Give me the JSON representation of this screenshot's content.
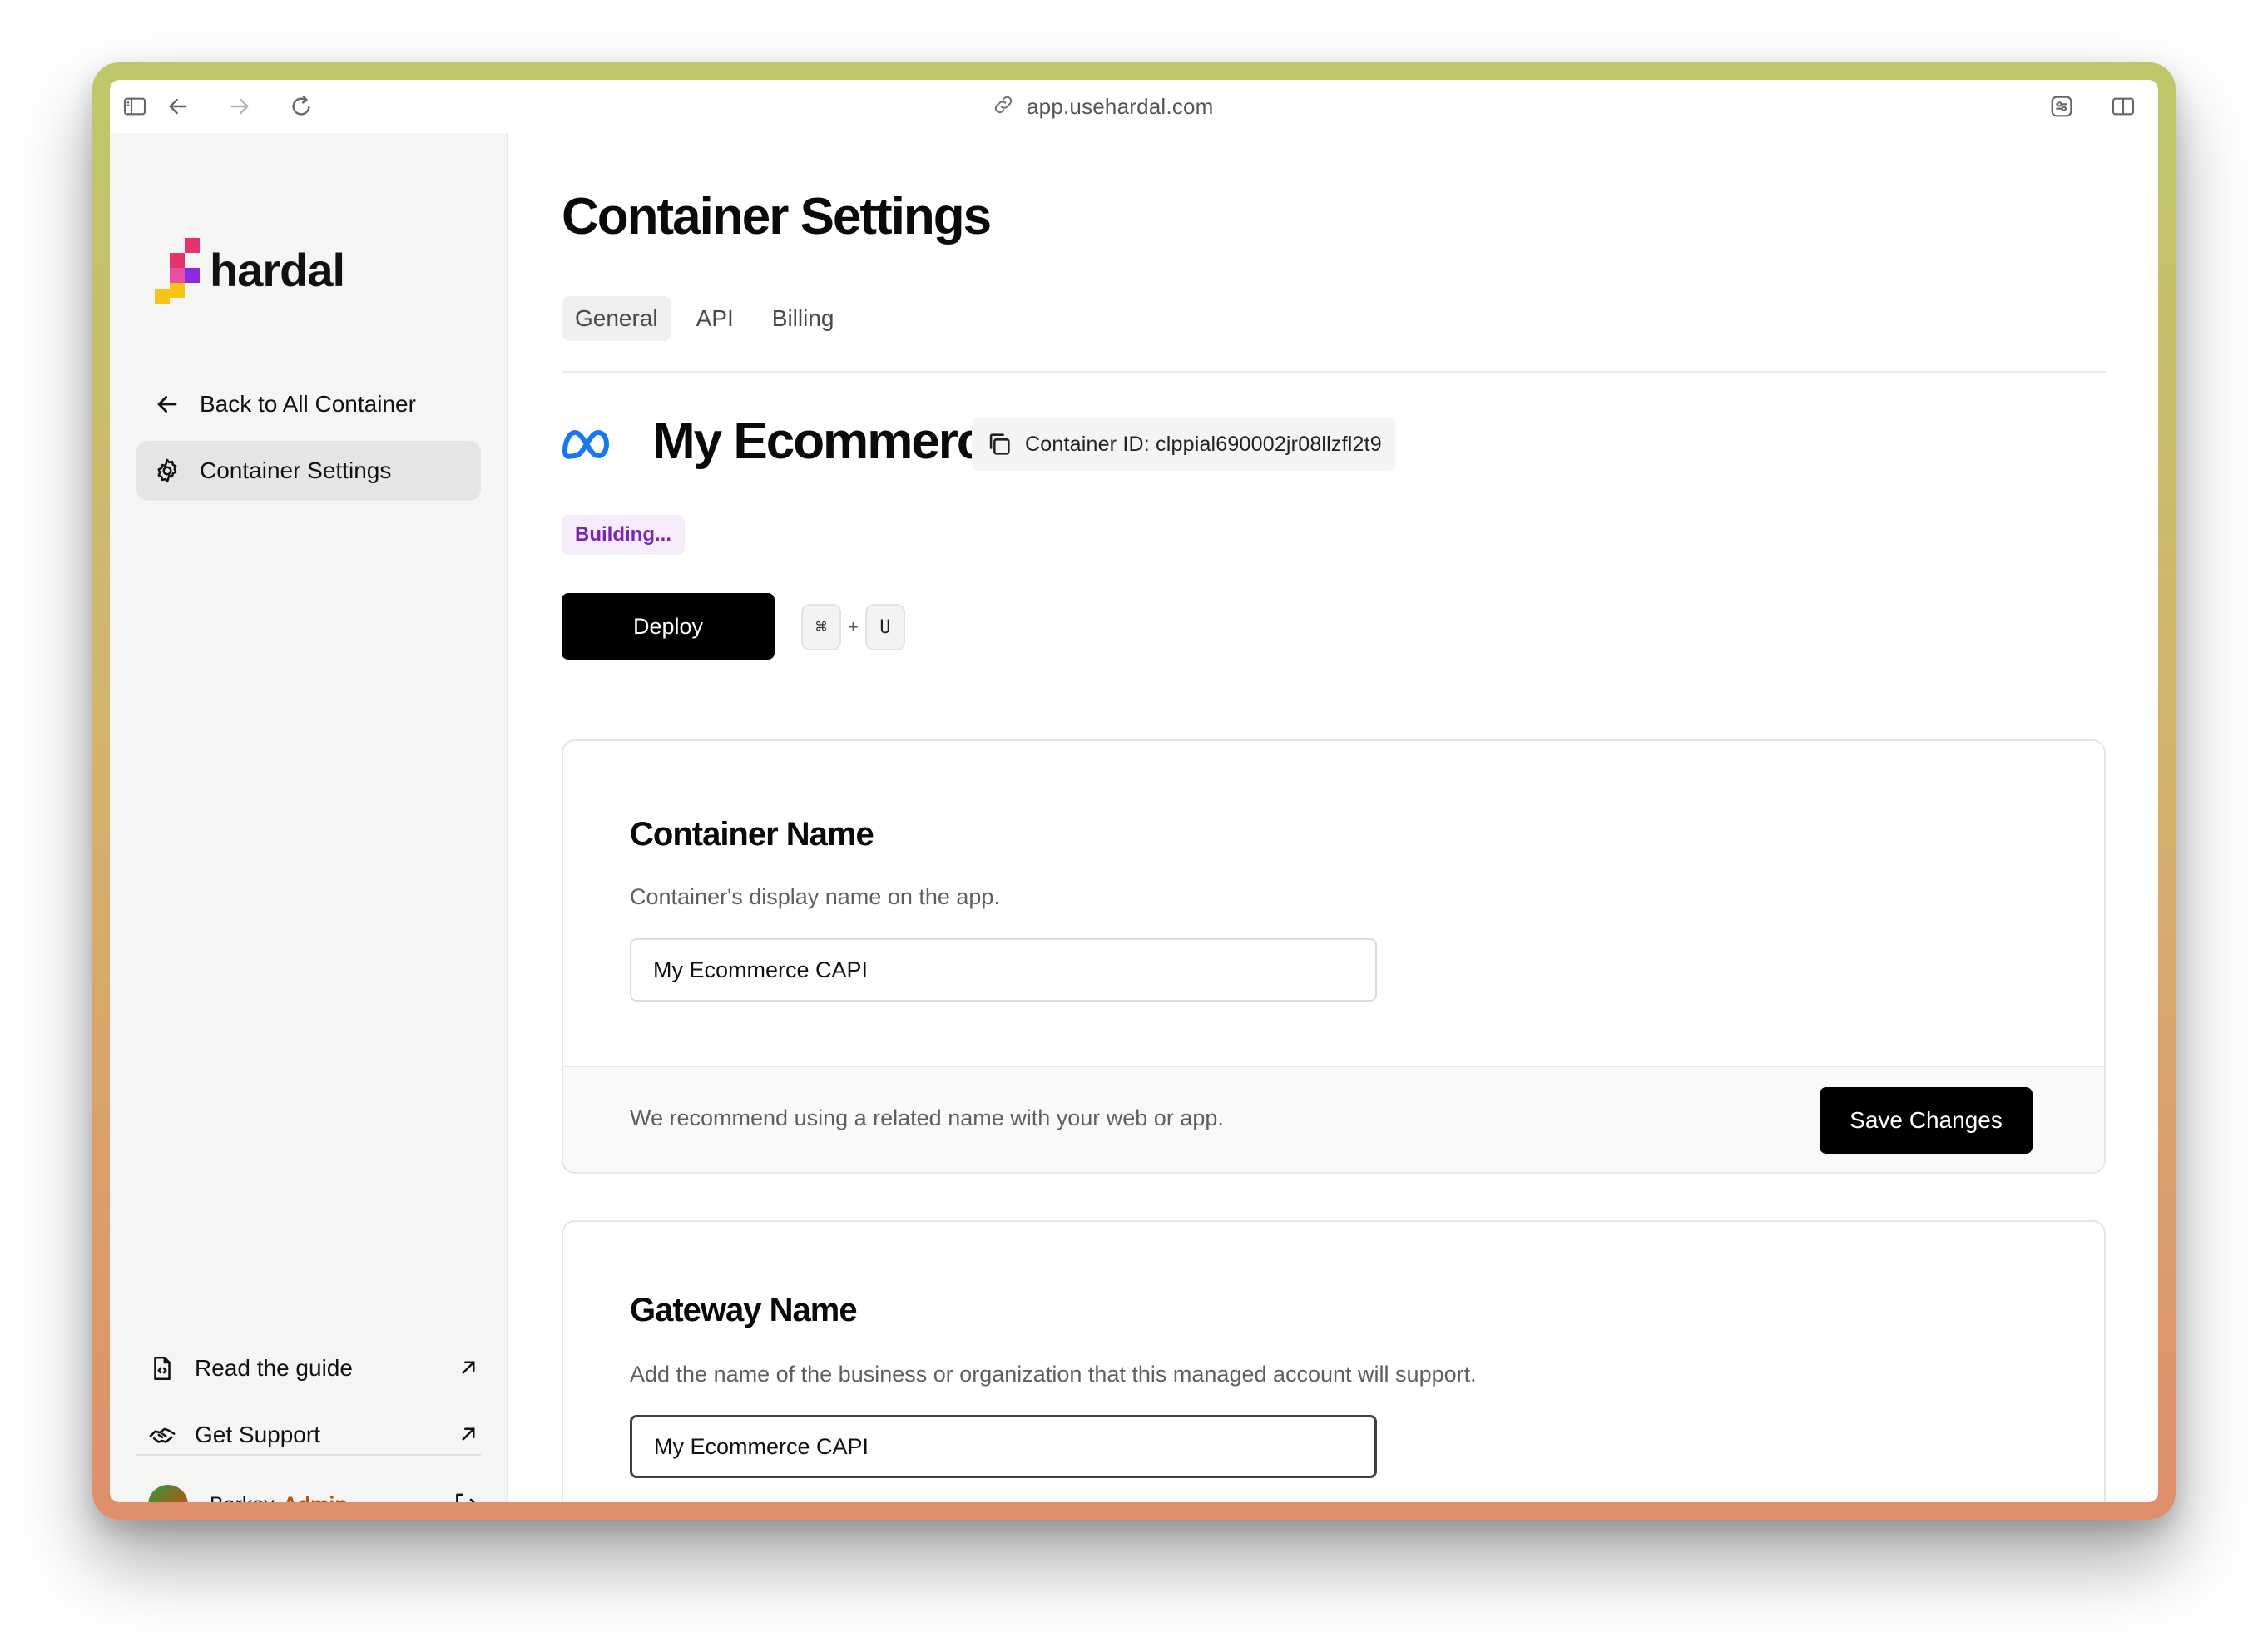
{
  "browser": {
    "url": "app.usehardal.com",
    "icons": [
      "sidebar-toggle-icon",
      "back-arrow-icon",
      "forward-arrow-icon",
      "reload-icon",
      "link-icon",
      "extensions-icon",
      "split-view-icon"
    ]
  },
  "sidebar": {
    "brand": "hardal",
    "nav": [
      {
        "label": "Back to All Container",
        "icon": "arrow-left-icon"
      },
      {
        "label": "Container Settings",
        "icon": "gear-icon",
        "active": true
      }
    ],
    "footer": [
      {
        "label": "Read the guide",
        "icon": "document-icon"
      },
      {
        "label": "Get Support",
        "icon": "handshake-icon"
      }
    ],
    "user": {
      "name": "Berkay",
      "role": "Admin"
    }
  },
  "main": {
    "title": "Container Settings",
    "tabs": [
      {
        "label": "General",
        "active": true
      },
      {
        "label": "API"
      },
      {
        "label": "Billing"
      }
    ],
    "container": {
      "name": "My Ecommerce CAPI",
      "id_text": "Container ID: clppial690002jr08llzfl2t9",
      "status": "Building..."
    },
    "deploy": {
      "label": "Deploy",
      "shortcut_keys": [
        "⌘",
        "U"
      ],
      "shortcut_joiner": "+"
    },
    "cards": {
      "container_name": {
        "title": "Container Name",
        "description": "Container's display name on the app.",
        "value": "My Ecommerce CAPI",
        "footer_note": "We recommend using a related name with your web or app.",
        "save_label": "Save Changes"
      },
      "gateway_name": {
        "title": "Gateway Name",
        "description": "Add the name of the business or organization that this managed account will support.",
        "value": "My Ecommerce CAPI"
      }
    }
  },
  "colors": {
    "accent_primary": "#000000",
    "status_purple": "#7a26b3",
    "status_bg": "#f6ecfb",
    "meta_blue": "#1877f2",
    "admin_orange": "#b4540c",
    "logo_pink": "#e6336f",
    "logo_purple": "#8a2be2",
    "logo_yellow": "#f5c518"
  }
}
